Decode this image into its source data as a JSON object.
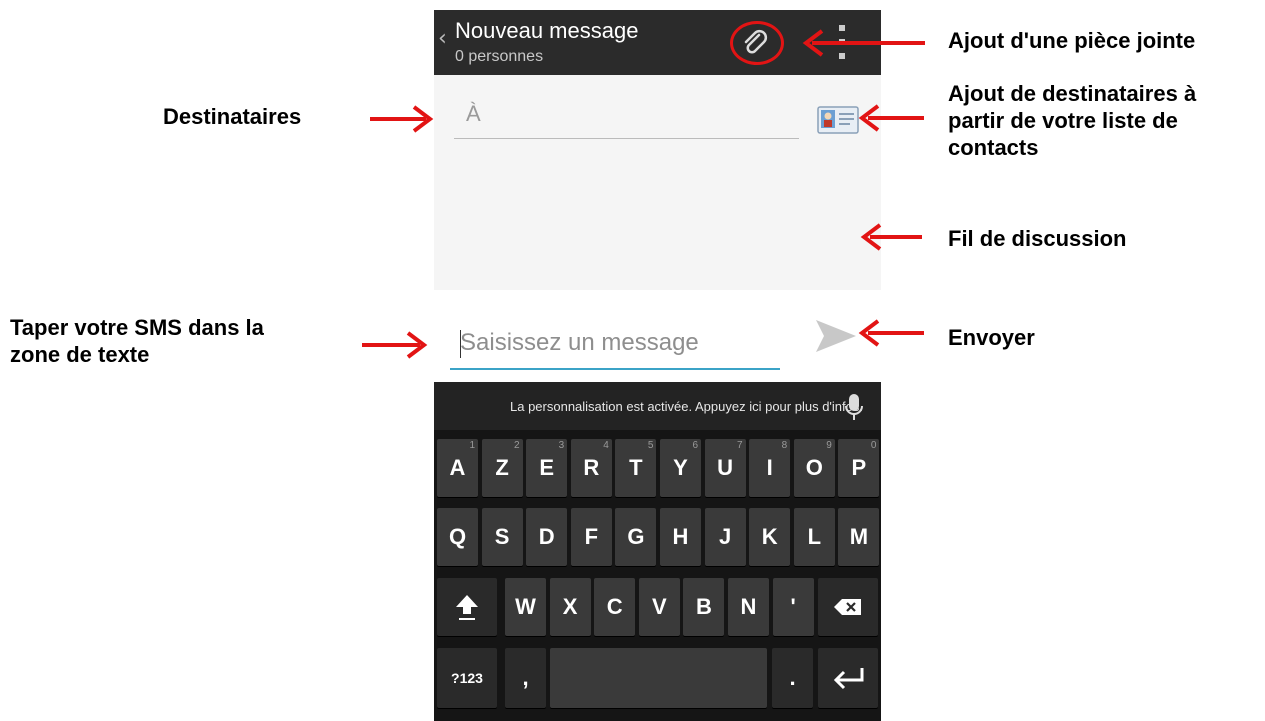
{
  "actionbar": {
    "back_glyph": "‹",
    "title": "Nouveau message",
    "subtitle": "0 personnes",
    "attach_icon": "paperclip-icon",
    "overflow_icon": "overflow-menu-icon"
  },
  "recipients": {
    "to_label": "À",
    "contacts_icon": "contact-card-icon"
  },
  "compose": {
    "placeholder": "Saisissez un message",
    "send_icon": "send-icon"
  },
  "keyboard": {
    "suggestion_text": "La personnalisation est activée. Appuyez ici pour plus d'infos.",
    "row1": [
      "A",
      "Z",
      "E",
      "R",
      "T",
      "Y",
      "U",
      "I",
      "O",
      "P"
    ],
    "row1_hints": [
      "1",
      "2",
      "3",
      "4",
      "5",
      "6",
      "7",
      "8",
      "9",
      "0"
    ],
    "row2": [
      "Q",
      "S",
      "D",
      "F",
      "G",
      "H",
      "J",
      "K",
      "L",
      "M"
    ],
    "row3": [
      "W",
      "X",
      "C",
      "V",
      "B",
      "N",
      "'"
    ],
    "symbols_label": "?123",
    "comma_label": ",",
    "period_label": "."
  },
  "annotations": {
    "attachment": "Ajout d'une pièce jointe",
    "recipients": "Destinataires",
    "contacts_l1": "Ajout de destinataires à",
    "contacts_l2": "partir de votre liste de",
    "contacts_l3": "contacts",
    "thread": "Fil de discussion",
    "type_sms_l1": "Taper votre SMS dans la",
    "type_sms_l2": "zone de texte",
    "send": "Envoyer"
  },
  "colors": {
    "annotation_arrow": "#e21414",
    "accent": "#3ba3c7",
    "actionbar": "#2b2b2b",
    "keyboard": "#151515"
  }
}
